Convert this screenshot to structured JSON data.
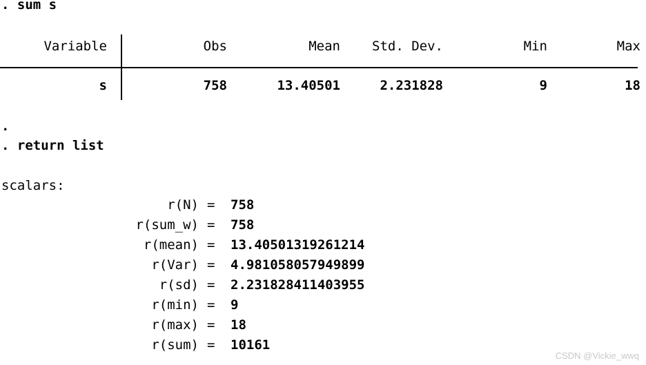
{
  "console": {
    "command_1": ". sum s",
    "blank_prompt": ".",
    "command_2": ". return list",
    "scalars_header": "scalars:"
  },
  "summarize_table": {
    "headers": {
      "variable": "Variable",
      "obs": "Obs",
      "mean": "Mean",
      "std_dev": "Std. Dev.",
      "min": "Min",
      "max": "Max"
    },
    "row": {
      "variable": "s",
      "obs": "758",
      "mean": "13.40501",
      "std_dev": "2.231828",
      "min": "9",
      "max": "18"
    }
  },
  "scalars": [
    {
      "label": "r(N)",
      "eq": "=",
      "value": "758"
    },
    {
      "label": "r(sum_w)",
      "eq": "=",
      "value": "758"
    },
    {
      "label": "r(mean)",
      "eq": "=",
      "value": "13.40501319261214"
    },
    {
      "label": "r(Var)",
      "eq": "=",
      "value": "4.981058057949899"
    },
    {
      "label": "r(sd)",
      "eq": "=",
      "value": "2.231828411403955"
    },
    {
      "label": "r(min)",
      "eq": "=",
      "value": "9"
    },
    {
      "label": "r(max)",
      "eq": "=",
      "value": "18"
    },
    {
      "label": "r(sum)",
      "eq": "=",
      "value": "10161"
    }
  ],
  "watermark": {
    "text": "CSDN @Vickie_wwq"
  },
  "colors": {
    "background": "#ffffff",
    "text": "#000000",
    "rule": "#000000",
    "watermark": "#c9c9c9"
  }
}
